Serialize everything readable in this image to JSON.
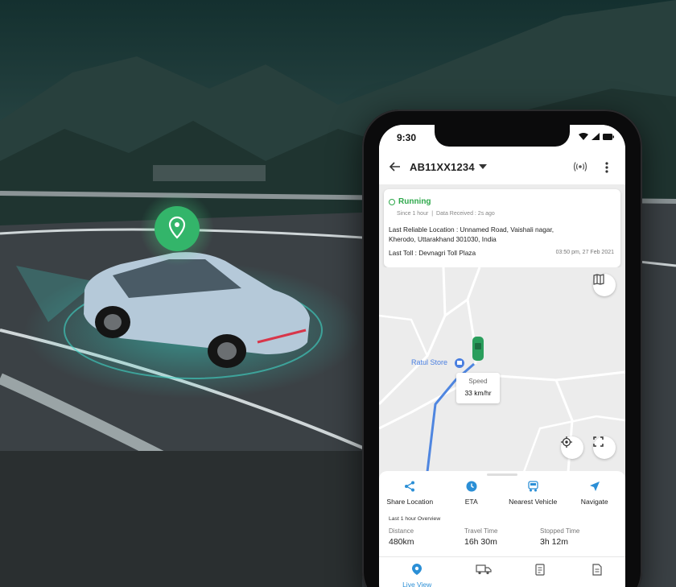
{
  "colors": {
    "accent": "#2b8fd6",
    "running": "#2ea84b",
    "pin": "#33b56a",
    "car_marker": "#2a9e5c",
    "route": "#4f86e0"
  },
  "status_bar": {
    "time": "9:30"
  },
  "app_bar": {
    "vehicle_number": "AB11XX1234",
    "back_icon": "arrow-left-icon",
    "dropdown_icon": "caret-down-icon",
    "signal_icon": "signal-broadcast-icon",
    "more_icon": "more-vertical-icon"
  },
  "info_card": {
    "status": "Running",
    "since": "Since 1 hour",
    "separator": "|",
    "data_received": "Data Received : 2s ago",
    "location_line1": "Last Reliable Location : Unnamed Road, Vaishali nagar,",
    "location_line2": "Kherodo, Uttarakhand 301030, India",
    "last_toll": "Last Toll :  Devnagri Toll Plaza",
    "timestamp": "03:50 pm, 27 Feb 2021"
  },
  "map": {
    "store_label": "Ratul Store",
    "speed_label": "Speed",
    "speed_value": "33 km/hr",
    "layers_icon": "map-layers-icon",
    "locate_icon": "crosshair-icon",
    "fullscreen_icon": "fullscreen-icon"
  },
  "actions": [
    {
      "label": "Share Location",
      "icon": "share-icon"
    },
    {
      "label": "ETA",
      "icon": "clock-icon"
    },
    {
      "label": "Nearest Vehicle",
      "icon": "vehicle-icon"
    },
    {
      "label": "Navigate",
      "icon": "navigate-icon"
    }
  ],
  "overview": {
    "title": "Last 1 hour Overview",
    "stats": [
      {
        "label": "Distance",
        "value": "480km"
      },
      {
        "label": "Travel Time",
        "value": "16h 30m"
      },
      {
        "label": "Stopped Time",
        "value": "3h 12m"
      }
    ]
  },
  "tabs": [
    {
      "label": "Live View",
      "icon": "location-pin-icon"
    },
    {
      "label": "",
      "icon": "truck-icon"
    },
    {
      "label": "",
      "icon": "report-icon"
    },
    {
      "label": "",
      "icon": "document-icon"
    }
  ]
}
